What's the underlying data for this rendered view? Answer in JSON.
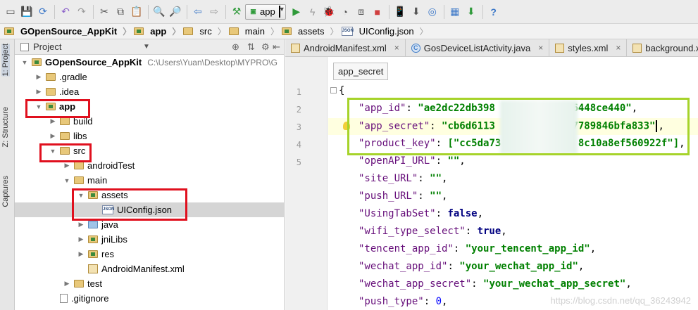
{
  "toolbar": {
    "run_config": "app",
    "icons": [
      "save-icon",
      "save-all-icon",
      "sync-icon",
      "undo-icon",
      "redo-icon",
      "cut-icon",
      "copy-icon",
      "paste-icon",
      "find-icon",
      "replace-icon",
      "back-icon",
      "forward-icon",
      "make-icon",
      "run-icon",
      "apply-changes-icon",
      "debug-icon",
      "profile-icon",
      "attach-debugger-icon",
      "stop-icon",
      "avd-manager-icon",
      "sdk-manager-icon",
      "sync-gradle-icon",
      "project-structure-icon",
      "android-monitor-icon",
      "help-icon"
    ]
  },
  "breadcrumb": [
    "GOpenSource_AppKit",
    "app",
    "src",
    "main",
    "assets",
    "UIConfig.json"
  ],
  "side_tabs": [
    "1: Project",
    "Z: Structure",
    "Captures"
  ],
  "project_panel": {
    "title": "Project",
    "tree": [
      {
        "label": "GOpenSource_AppKit",
        "path": "C:\\Users\\Yuan\\Desktop\\MYPRO\\G",
        "indent": 0,
        "expanded": true,
        "icon": "module-folder",
        "bold": true
      },
      {
        "label": ".gradle",
        "indent": 1,
        "expanded": false,
        "icon": "folder"
      },
      {
        "label": ".idea",
        "indent": 1,
        "expanded": false,
        "icon": "folder"
      },
      {
        "label": "app",
        "indent": 1,
        "expanded": true,
        "icon": "module-folder",
        "bold": true
      },
      {
        "label": "build",
        "indent": 2,
        "expanded": false,
        "icon": "folder"
      },
      {
        "label": "libs",
        "indent": 2,
        "expanded": false,
        "icon": "folder"
      },
      {
        "label": "src",
        "indent": 2,
        "expanded": true,
        "icon": "folder"
      },
      {
        "label": "androidTest",
        "indent": 3,
        "expanded": false,
        "icon": "folder"
      },
      {
        "label": "main",
        "indent": 3,
        "expanded": true,
        "icon": "folder"
      },
      {
        "label": "assets",
        "indent": 4,
        "expanded": true,
        "icon": "resource-folder"
      },
      {
        "label": "UIConfig.json",
        "indent": 5,
        "icon": "json",
        "selected": true
      },
      {
        "label": "java",
        "indent": 4,
        "expanded": false,
        "icon": "source-folder"
      },
      {
        "label": "jniLibs",
        "indent": 4,
        "expanded": false,
        "icon": "resource-folder"
      },
      {
        "label": "res",
        "indent": 4,
        "expanded": false,
        "icon": "resource-folder"
      },
      {
        "label": "AndroidManifest.xml",
        "indent": 4,
        "icon": "xml"
      },
      {
        "label": "test",
        "indent": 3,
        "expanded": false,
        "icon": "folder"
      },
      {
        "label": ".gitignore",
        "indent": 2,
        "icon": "file"
      }
    ]
  },
  "editor_tabs": [
    {
      "label": "AndroidManifest.xml",
      "icon": "xml"
    },
    {
      "label": "GosDeviceListActivity.java",
      "icon": "class"
    },
    {
      "label": "styles.xml",
      "icon": "xml"
    },
    {
      "label": "background.xml",
      "icon": "xml"
    }
  ],
  "editor": {
    "tooltip": "app_secret",
    "line_numbers": [
      "1",
      "2",
      "3",
      "4",
      "5"
    ],
    "json_lines": [
      {
        "key": null,
        "raw": "{"
      },
      {
        "key": "\"app_id\"",
        "value": "\"ae2dc22db398",
        "value_tail": "6448ce440\"",
        "type": "str"
      },
      {
        "key": "\"app_secret\"",
        "value": "\"cb6d6113",
        "value_tail": "7789846bfa833\"",
        "type": "str"
      },
      {
        "key": "\"product_key\"",
        "value": "[\"cc5da73",
        "value_tail": "8c10a8ef560922f\"]",
        "type": "str"
      },
      {
        "key": "\"openAPI_URL\"",
        "value": "\"\"",
        "type": "str"
      },
      {
        "key": "\"site_URL\"",
        "value": "\"\"",
        "type": "str"
      },
      {
        "key": "\"push_URL\"",
        "value": "\"\"",
        "type": "str"
      },
      {
        "key": "\"UsingTabSet\"",
        "value": "false",
        "type": "bool"
      },
      {
        "key": "\"wifi_type_select\"",
        "value": "true",
        "type": "bool"
      },
      {
        "key": "\"tencent_app_id\"",
        "value": "\"your_tencent_app_id\"",
        "type": "str"
      },
      {
        "key": "\"wechat_app_id\"",
        "value": "\"your_wechat_app_id\"",
        "type": "str"
      },
      {
        "key": "\"wechat_app_secret\"",
        "value": "\"your_wechat_app_secret\"",
        "type": "str"
      },
      {
        "key": "\"push_type\"",
        "value": "0",
        "type": "num"
      }
    ]
  },
  "watermark": "https://blog.csdn.net/qq_36243942",
  "colors": {
    "red_highlight": "#e0101e",
    "green_highlight": "#a6d32a"
  }
}
